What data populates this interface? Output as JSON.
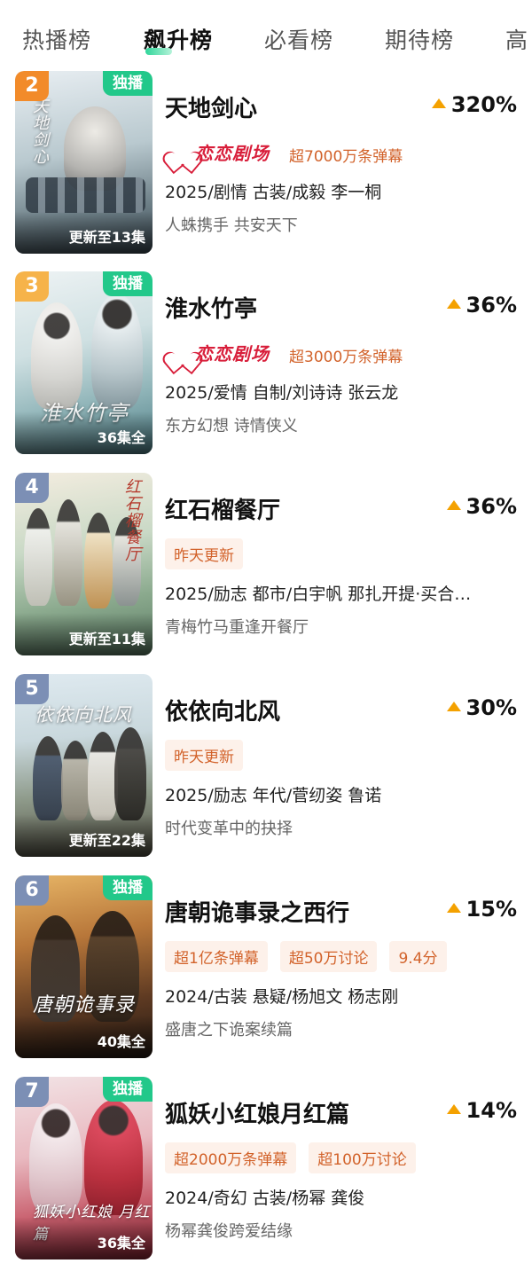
{
  "tabs": [
    "热播榜",
    "飙升榜",
    "必看榜",
    "期待榜",
    "高"
  ],
  "active_tab": 1,
  "items": [
    {
      "rank": "2",
      "rank_color": "#f28b2a",
      "exclusive": "独播",
      "episodes": "更新至13集",
      "title": "天地剑心",
      "trend": "320%",
      "platform": "恋恋剧场",
      "platform_danmu": "超7000万条弹幕",
      "meta": "2025/剧情 古装/成毅 李一桐",
      "desc": "人蛛携手 共安天下",
      "poster_calligraphy": "天地剑心"
    },
    {
      "rank": "3",
      "rank_color": "#f6b34a",
      "exclusive": "独播",
      "episodes": "36集全",
      "title": "淮水竹亭",
      "trend": "36%",
      "platform": "恋恋剧场",
      "platform_danmu": "超3000万条弹幕",
      "meta": "2025/爱情 自制/刘诗诗 张云龙",
      "desc": "东方幻想 诗情侠义",
      "poster_calligraphy": "淮水竹亭"
    },
    {
      "rank": "4",
      "rank_color": "#7c8fb5",
      "episodes": "更新至11集",
      "title": "红石榴餐厅",
      "trend": "36%",
      "tags": [
        "昨天更新"
      ],
      "meta": "2025/励志 都市/白宇帆 那扎开提·买合…",
      "desc": "青梅竹马重逢开餐厅",
      "poster_calligraphy": "红石榴餐厅"
    },
    {
      "rank": "5",
      "rank_color": "#7c8fb5",
      "episodes": "更新至22集",
      "title": "依依向北风",
      "trend": "30%",
      "tags": [
        "昨天更新"
      ],
      "meta": "2025/励志 年代/菅纫姿 鲁诺",
      "desc": "时代变革中的抉择",
      "poster_calligraphy": "依依向北风"
    },
    {
      "rank": "6",
      "rank_color": "#7c8fb5",
      "exclusive": "独播",
      "episodes": "40集全",
      "title": "唐朝诡事录之西行",
      "trend": "15%",
      "tags": [
        "超1亿条弹幕",
        "超50万讨论",
        "9.4分"
      ],
      "meta": "2024/古装 悬疑/杨旭文 杨志刚",
      "desc": "盛唐之下诡案续篇",
      "poster_calligraphy": "唐朝诡事录"
    },
    {
      "rank": "7",
      "rank_color": "#7c8fb5",
      "exclusive": "独播",
      "episodes": "36集全",
      "title": "狐妖小红娘月红篇",
      "trend": "14%",
      "tags": [
        "超2000万条弹幕",
        "超100万讨论"
      ],
      "meta": "2024/奇幻 古装/杨幂 龚俊",
      "desc": "杨幂龚俊跨爱结缘",
      "poster_calligraphy": "狐妖小红娘 月红篇"
    }
  ],
  "colors": {
    "accent_green": "#22c88a",
    "tag_orange": "#d2622a",
    "trend_arrow": "#f4a100",
    "platform_red": "#d81e3a"
  },
  "icons": {
    "trend": "trend-up-triangle-icon",
    "platform": "heart-logo-icon"
  }
}
